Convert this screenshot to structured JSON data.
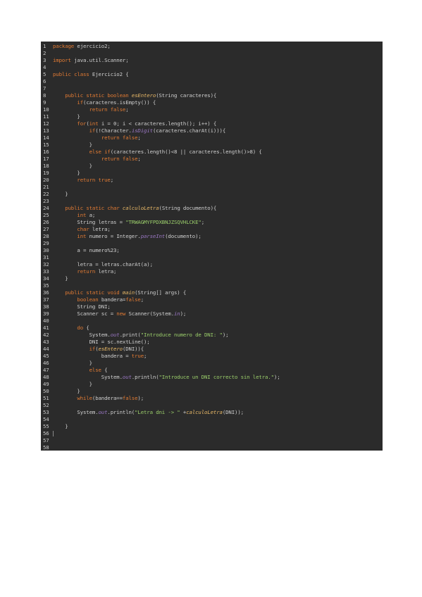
{
  "editor": {
    "lines": [
      [
        [
          "kw",
          "package "
        ],
        [
          "plain",
          "ejercicio2;"
        ]
      ],
      [],
      [
        [
          "kw",
          "import "
        ],
        [
          "plain",
          "java.util.Scanner;"
        ]
      ],
      [],
      [
        [
          "kw",
          "public class "
        ],
        [
          "plain",
          "Ejercicio2 {"
        ]
      ],
      [],
      [],
      [
        [
          "plain",
          "    "
        ],
        [
          "kw",
          "public static boolean "
        ],
        [
          "fn",
          "esEntero"
        ],
        [
          "plain",
          "(String caracteres){"
        ]
      ],
      [
        [
          "plain",
          "        "
        ],
        [
          "kw",
          "if"
        ],
        [
          "plain",
          "(caracteres.isEmpty()) {"
        ]
      ],
      [
        [
          "plain",
          "            "
        ],
        [
          "kw",
          "return false"
        ],
        [
          "plain",
          ";"
        ]
      ],
      [
        [
          "plain",
          "        }"
        ]
      ],
      [
        [
          "plain",
          "        "
        ],
        [
          "kw",
          "for"
        ],
        [
          "plain",
          "("
        ],
        [
          "kw",
          "int "
        ],
        [
          "plain",
          "i = 0; i < caracteres.length(); i++) {"
        ]
      ],
      [
        [
          "plain",
          "            "
        ],
        [
          "kw",
          "if"
        ],
        [
          "plain",
          "(!Character."
        ],
        [
          "st",
          "isDigit"
        ],
        [
          "plain",
          "(caracteres.charAt(i))){"
        ]
      ],
      [
        [
          "plain",
          "                "
        ],
        [
          "kw",
          "return false"
        ],
        [
          "plain",
          ";"
        ]
      ],
      [
        [
          "plain",
          "            }"
        ]
      ],
      [
        [
          "plain",
          "            "
        ],
        [
          "kw",
          "else if"
        ],
        [
          "plain",
          "(caracteres.length()<8 || caracteres.length()>8) {"
        ]
      ],
      [
        [
          "plain",
          "                "
        ],
        [
          "kw",
          "return false"
        ],
        [
          "plain",
          ";"
        ]
      ],
      [
        [
          "plain",
          "            }"
        ]
      ],
      [
        [
          "plain",
          "        }"
        ]
      ],
      [
        [
          "plain",
          "        "
        ],
        [
          "kw",
          "return true"
        ],
        [
          "plain",
          ";"
        ]
      ],
      [],
      [
        [
          "plain",
          "    }"
        ]
      ],
      [],
      [
        [
          "plain",
          "    "
        ],
        [
          "kw",
          "public static char "
        ],
        [
          "fn",
          "calculoLetra"
        ],
        [
          "plain",
          "(String documento){"
        ]
      ],
      [
        [
          "plain",
          "        "
        ],
        [
          "kw",
          "int "
        ],
        [
          "plain",
          "a;"
        ]
      ],
      [
        [
          "plain",
          "        String letras = "
        ],
        [
          "str",
          "\"TRWAGMYFPDXBNJZSQVHLCKE\""
        ],
        [
          "plain",
          ";"
        ]
      ],
      [
        [
          "plain",
          "        "
        ],
        [
          "kw",
          "char "
        ],
        [
          "plain",
          "letra;"
        ]
      ],
      [
        [
          "plain",
          "        "
        ],
        [
          "kw",
          "int "
        ],
        [
          "plain",
          "numero = Integer."
        ],
        [
          "st",
          "parseInt"
        ],
        [
          "plain",
          "(documento);"
        ]
      ],
      [],
      [
        [
          "plain",
          "        a = numero%23;"
        ]
      ],
      [],
      [
        [
          "plain",
          "        letra = letras.charAt(a);"
        ]
      ],
      [
        [
          "plain",
          "        "
        ],
        [
          "kw",
          "return "
        ],
        [
          "plain",
          "letra;"
        ]
      ],
      [
        [
          "plain",
          "    }"
        ]
      ],
      [],
      [
        [
          "plain",
          "    "
        ],
        [
          "kw",
          "public static void "
        ],
        [
          "fn",
          "main"
        ],
        [
          "plain",
          "(String[] args) {"
        ]
      ],
      [
        [
          "plain",
          "        "
        ],
        [
          "kw",
          "boolean "
        ],
        [
          "plain",
          "bandera="
        ],
        [
          "kw",
          "false"
        ],
        [
          "plain",
          ";"
        ]
      ],
      [
        [
          "plain",
          "        String DNI;"
        ]
      ],
      [
        [
          "plain",
          "        Scanner sc = "
        ],
        [
          "kw",
          "new "
        ],
        [
          "plain",
          "Scanner(System."
        ],
        [
          "st",
          "in"
        ],
        [
          "plain",
          ");"
        ]
      ],
      [],
      [
        [
          "plain",
          "        "
        ],
        [
          "kw",
          "do "
        ],
        [
          "plain",
          "{"
        ]
      ],
      [
        [
          "plain",
          "            System."
        ],
        [
          "st",
          "out"
        ],
        [
          "plain",
          ".print("
        ],
        [
          "str",
          "\"Introduce numero de DNI: \""
        ],
        [
          "plain",
          ");"
        ]
      ],
      [
        [
          "plain",
          "            DNI = sc.nextLine();"
        ]
      ],
      [
        [
          "plain",
          "            "
        ],
        [
          "kw",
          "if"
        ],
        [
          "plain",
          "("
        ],
        [
          "fn",
          "esEntero"
        ],
        [
          "plain",
          "(DNI)){"
        ]
      ],
      [
        [
          "plain",
          "                bandera = "
        ],
        [
          "kw",
          "true"
        ],
        [
          "plain",
          ";"
        ]
      ],
      [
        [
          "plain",
          "            }"
        ]
      ],
      [
        [
          "plain",
          "            "
        ],
        [
          "kw",
          "else "
        ],
        [
          "plain",
          "{"
        ]
      ],
      [
        [
          "plain",
          "                System."
        ],
        [
          "st",
          "out"
        ],
        [
          "plain",
          ".println("
        ],
        [
          "str",
          "\"Introduce un DNI correcto sin letra.\""
        ],
        [
          "plain",
          ");"
        ]
      ],
      [
        [
          "plain",
          "            }"
        ]
      ],
      [
        [
          "plain",
          "        }"
        ]
      ],
      [
        [
          "plain",
          "        "
        ],
        [
          "kw",
          "while"
        ],
        [
          "plain",
          "(bandera=="
        ],
        [
          "kw",
          "false"
        ],
        [
          "plain",
          ");"
        ]
      ],
      [],
      [
        [
          "plain",
          "        System."
        ],
        [
          "st",
          "out"
        ],
        [
          "plain",
          ".println("
        ],
        [
          "str",
          "\"Letra dni -> \""
        ],
        [
          "plain",
          " +"
        ],
        [
          "fn",
          "calculoLetra"
        ],
        [
          "plain",
          "(DNI));"
        ]
      ],
      [],
      [
        [
          "plain",
          "    }"
        ]
      ],
      [
        [
          "cursor",
          ""
        ]
      ],
      [],
      []
    ]
  }
}
